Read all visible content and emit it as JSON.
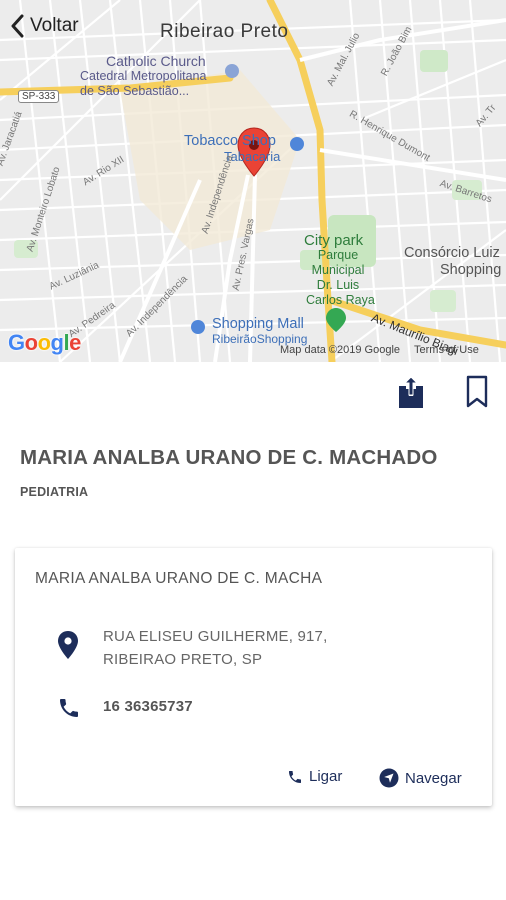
{
  "header": {
    "back_label": "Voltar"
  },
  "map": {
    "city": "Ribeirao Preto",
    "pois": {
      "church": "Catholic Church",
      "cathedral_line1": "Catedral Metropolitana",
      "cathedral_line2": "de São Sebastião...",
      "tobacco": "Tobacco Shop",
      "tab": "Tabacaria",
      "citypark": "City park",
      "parque_line1": "Parque",
      "parque_line2": "Municipal",
      "parque_line3": "Dr. Luis",
      "parque_line4": "Carlos Raya",
      "consorcio_line1": "Consórcio Luiz",
      "consorcio_line2": "Shopping",
      "mall": "Shopping Mall",
      "ribeiraoshopping": "RibeirãoShopping"
    },
    "roads": {
      "sp333": "SP-333",
      "independencia": "Av. Independência",
      "independencia2": "Av. Independência",
      "pres_vargas": "Av. Pres. Vargas",
      "maurilio": "Av. Maurílio Biagi",
      "rio_xii": "Av. Rio XII",
      "montero_lobato": "Av. Monteiro Lobato",
      "luziania": "Av. Luziânia",
      "mal_julio": "Av. Mal. Julio",
      "joao_bim": "R. João Bim",
      "henrique_dumont": "R. Henrique Dumont",
      "tupi_av": "Av. Tr",
      "pedreira": "Av. Pedreira",
      "jacaraca": "Av. Jaracatiá",
      "barretos": "Av. Barretos"
    },
    "google": "Google",
    "map_data": "Map data ©2019 Google",
    "terms": "Terms of Use"
  },
  "profile": {
    "name": "MARIA ANALBA URANO DE C. MACHADO",
    "specialty": "PEDIATRIA"
  },
  "card": {
    "name": "MARIA ANALBA URANO DE C. MACHA",
    "address_line1": "RUA ELISEU GUILHERME, 917,",
    "address_line2": "RIBEIRAO PRETO, SP",
    "phone": "16 36365737",
    "call_label": "Ligar",
    "navigate_label": "Navegar"
  },
  "colors": {
    "accent": "#1d2d5a",
    "pin": "#ea4335"
  }
}
